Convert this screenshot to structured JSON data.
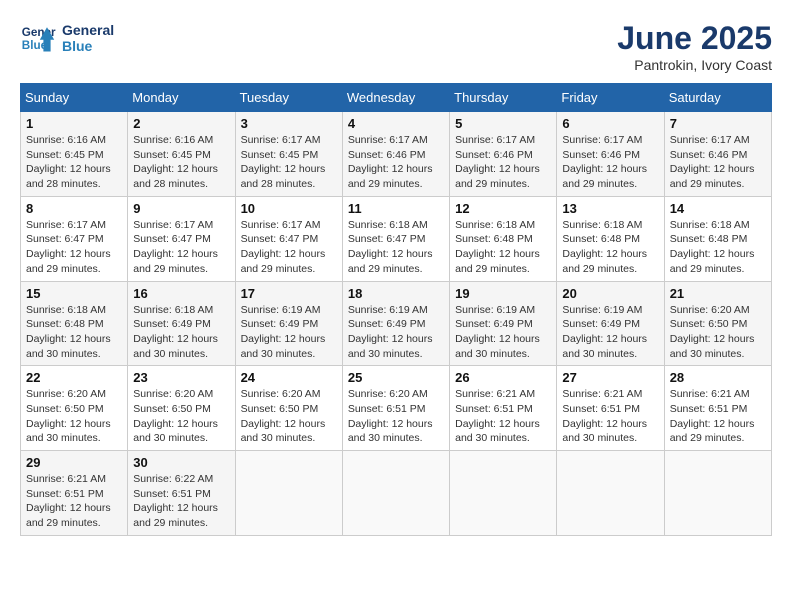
{
  "header": {
    "logo_line1": "General",
    "logo_line2": "Blue",
    "month": "June 2025",
    "location": "Pantrokin, Ivory Coast"
  },
  "weekdays": [
    "Sunday",
    "Monday",
    "Tuesday",
    "Wednesday",
    "Thursday",
    "Friday",
    "Saturday"
  ],
  "weeks": [
    [
      {
        "day": "1",
        "info": "Sunrise: 6:16 AM\nSunset: 6:45 PM\nDaylight: 12 hours\nand 28 minutes."
      },
      {
        "day": "2",
        "info": "Sunrise: 6:16 AM\nSunset: 6:45 PM\nDaylight: 12 hours\nand 28 minutes."
      },
      {
        "day": "3",
        "info": "Sunrise: 6:17 AM\nSunset: 6:45 PM\nDaylight: 12 hours\nand 28 minutes."
      },
      {
        "day": "4",
        "info": "Sunrise: 6:17 AM\nSunset: 6:46 PM\nDaylight: 12 hours\nand 29 minutes."
      },
      {
        "day": "5",
        "info": "Sunrise: 6:17 AM\nSunset: 6:46 PM\nDaylight: 12 hours\nand 29 minutes."
      },
      {
        "day": "6",
        "info": "Sunrise: 6:17 AM\nSunset: 6:46 PM\nDaylight: 12 hours\nand 29 minutes."
      },
      {
        "day": "7",
        "info": "Sunrise: 6:17 AM\nSunset: 6:46 PM\nDaylight: 12 hours\nand 29 minutes."
      }
    ],
    [
      {
        "day": "8",
        "info": "Sunrise: 6:17 AM\nSunset: 6:47 PM\nDaylight: 12 hours\nand 29 minutes."
      },
      {
        "day": "9",
        "info": "Sunrise: 6:17 AM\nSunset: 6:47 PM\nDaylight: 12 hours\nand 29 minutes."
      },
      {
        "day": "10",
        "info": "Sunrise: 6:17 AM\nSunset: 6:47 PM\nDaylight: 12 hours\nand 29 minutes."
      },
      {
        "day": "11",
        "info": "Sunrise: 6:18 AM\nSunset: 6:47 PM\nDaylight: 12 hours\nand 29 minutes."
      },
      {
        "day": "12",
        "info": "Sunrise: 6:18 AM\nSunset: 6:48 PM\nDaylight: 12 hours\nand 29 minutes."
      },
      {
        "day": "13",
        "info": "Sunrise: 6:18 AM\nSunset: 6:48 PM\nDaylight: 12 hours\nand 29 minutes."
      },
      {
        "day": "14",
        "info": "Sunrise: 6:18 AM\nSunset: 6:48 PM\nDaylight: 12 hours\nand 29 minutes."
      }
    ],
    [
      {
        "day": "15",
        "info": "Sunrise: 6:18 AM\nSunset: 6:48 PM\nDaylight: 12 hours\nand 30 minutes."
      },
      {
        "day": "16",
        "info": "Sunrise: 6:18 AM\nSunset: 6:49 PM\nDaylight: 12 hours\nand 30 minutes."
      },
      {
        "day": "17",
        "info": "Sunrise: 6:19 AM\nSunset: 6:49 PM\nDaylight: 12 hours\nand 30 minutes."
      },
      {
        "day": "18",
        "info": "Sunrise: 6:19 AM\nSunset: 6:49 PM\nDaylight: 12 hours\nand 30 minutes."
      },
      {
        "day": "19",
        "info": "Sunrise: 6:19 AM\nSunset: 6:49 PM\nDaylight: 12 hours\nand 30 minutes."
      },
      {
        "day": "20",
        "info": "Sunrise: 6:19 AM\nSunset: 6:49 PM\nDaylight: 12 hours\nand 30 minutes."
      },
      {
        "day": "21",
        "info": "Sunrise: 6:20 AM\nSunset: 6:50 PM\nDaylight: 12 hours\nand 30 minutes."
      }
    ],
    [
      {
        "day": "22",
        "info": "Sunrise: 6:20 AM\nSunset: 6:50 PM\nDaylight: 12 hours\nand 30 minutes."
      },
      {
        "day": "23",
        "info": "Sunrise: 6:20 AM\nSunset: 6:50 PM\nDaylight: 12 hours\nand 30 minutes."
      },
      {
        "day": "24",
        "info": "Sunrise: 6:20 AM\nSunset: 6:50 PM\nDaylight: 12 hours\nand 30 minutes."
      },
      {
        "day": "25",
        "info": "Sunrise: 6:20 AM\nSunset: 6:51 PM\nDaylight: 12 hours\nand 30 minutes."
      },
      {
        "day": "26",
        "info": "Sunrise: 6:21 AM\nSunset: 6:51 PM\nDaylight: 12 hours\nand 30 minutes."
      },
      {
        "day": "27",
        "info": "Sunrise: 6:21 AM\nSunset: 6:51 PM\nDaylight: 12 hours\nand 30 minutes."
      },
      {
        "day": "28",
        "info": "Sunrise: 6:21 AM\nSunset: 6:51 PM\nDaylight: 12 hours\nand 29 minutes."
      }
    ],
    [
      {
        "day": "29",
        "info": "Sunrise: 6:21 AM\nSunset: 6:51 PM\nDaylight: 12 hours\nand 29 minutes."
      },
      {
        "day": "30",
        "info": "Sunrise: 6:22 AM\nSunset: 6:51 PM\nDaylight: 12 hours\nand 29 minutes."
      },
      {
        "day": "",
        "info": ""
      },
      {
        "day": "",
        "info": ""
      },
      {
        "day": "",
        "info": ""
      },
      {
        "day": "",
        "info": ""
      },
      {
        "day": "",
        "info": ""
      }
    ]
  ]
}
